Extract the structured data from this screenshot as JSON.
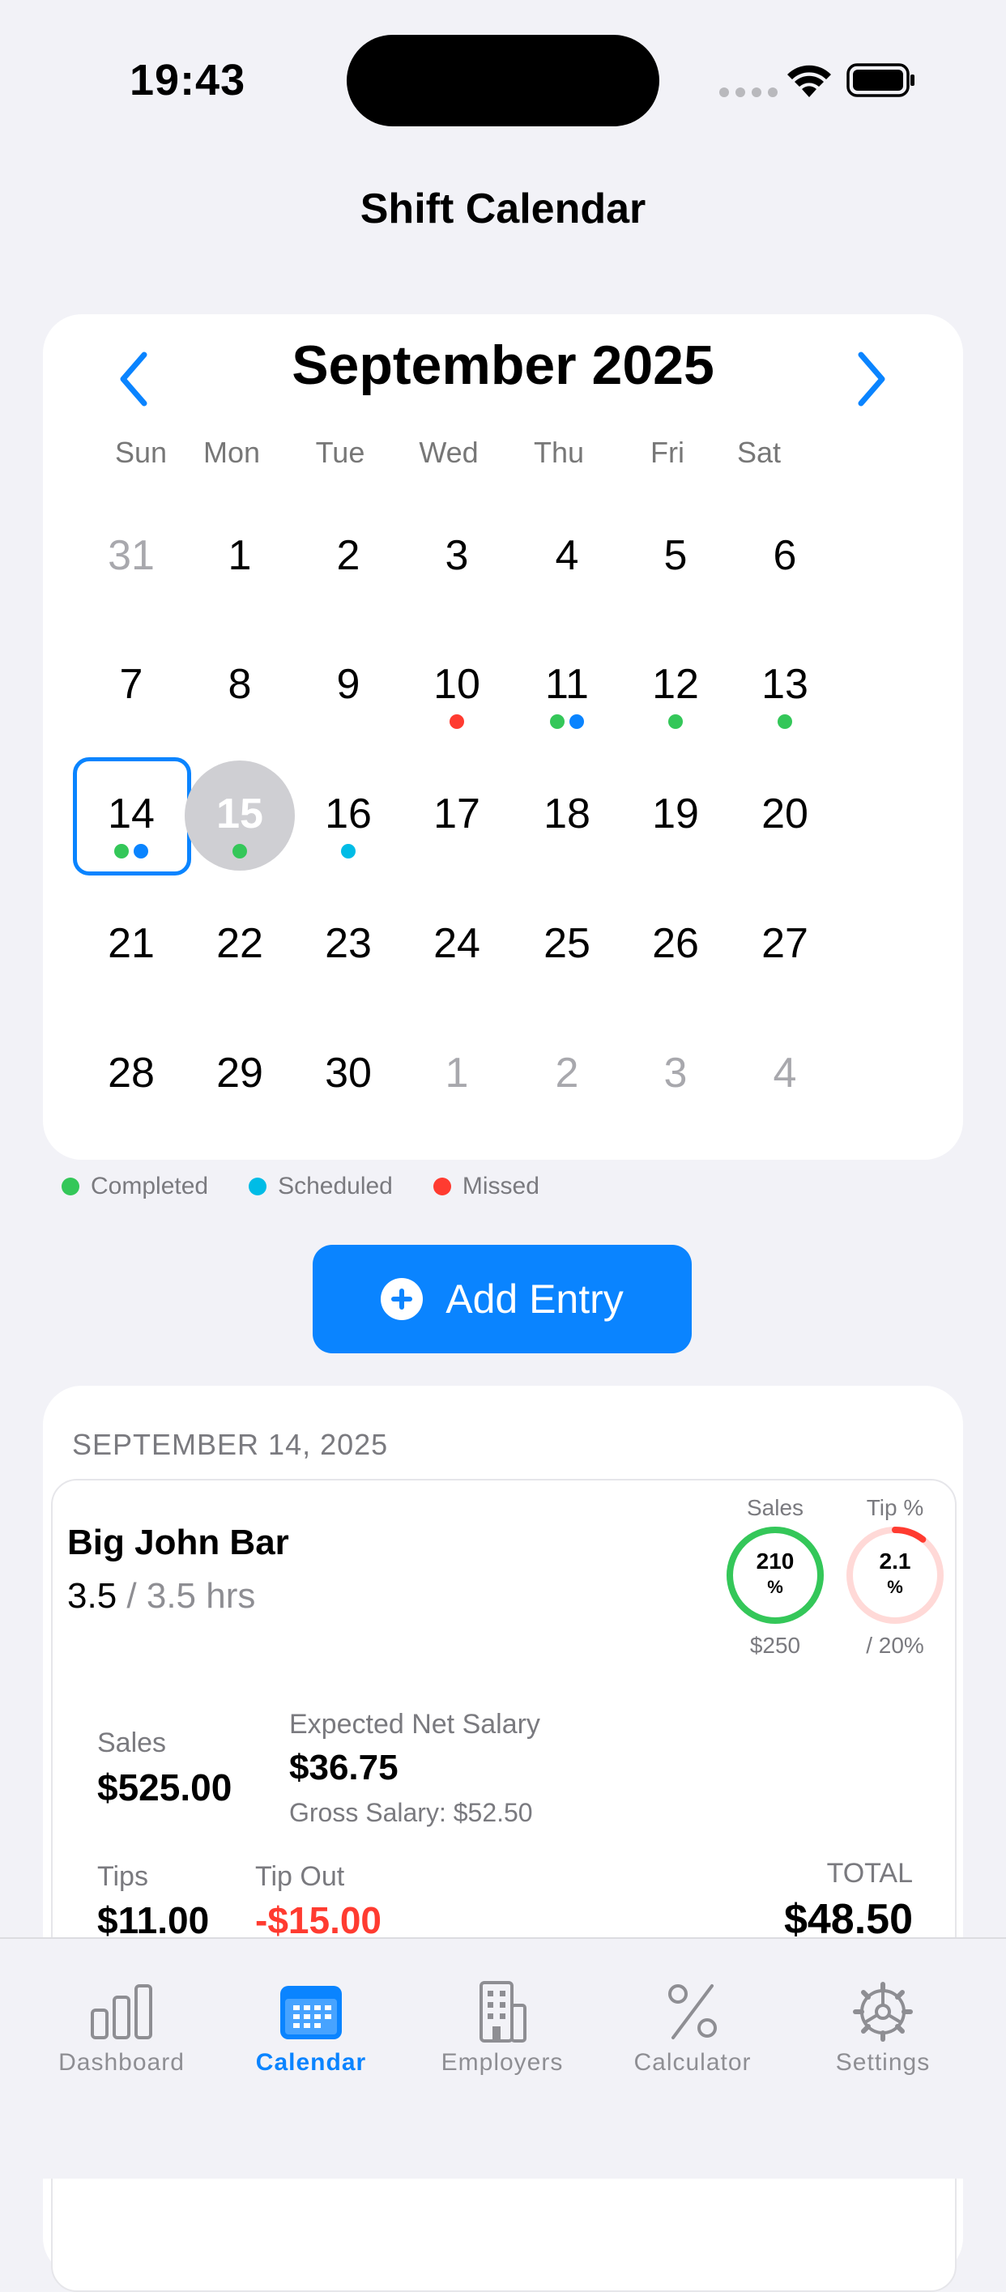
{
  "status_bar": {
    "time": "19:43"
  },
  "nav": {
    "title": "Shift Calendar"
  },
  "calendar": {
    "month_title": "September 2025",
    "weekdays": [
      "Sun",
      "Mon",
      "Tue",
      "Wed",
      "Thu",
      "Fri",
      "Sat"
    ],
    "weeks": [
      [
        {
          "d": "31",
          "muted": true
        },
        {
          "d": "1"
        },
        {
          "d": "2"
        },
        {
          "d": "3"
        },
        {
          "d": "4"
        },
        {
          "d": "5"
        },
        {
          "d": "6"
        }
      ],
      [
        {
          "d": "7"
        },
        {
          "d": "8"
        },
        {
          "d": "9"
        },
        {
          "d": "10",
          "dots": [
            "missed"
          ]
        },
        {
          "d": "11",
          "dots": [
            "completed",
            "blue"
          ]
        },
        {
          "d": "12",
          "dots": [
            "completed"
          ]
        },
        {
          "d": "13",
          "dots": [
            "completed"
          ]
        }
      ],
      [
        {
          "d": "14",
          "dots": [
            "completed",
            "blue"
          ],
          "selected": true
        },
        {
          "d": "15",
          "dots": [
            "completed"
          ],
          "today": true
        },
        {
          "d": "16",
          "dots": [
            "scheduled"
          ]
        },
        {
          "d": "17"
        },
        {
          "d": "18"
        },
        {
          "d": "19"
        },
        {
          "d": "20"
        }
      ],
      [
        {
          "d": "21"
        },
        {
          "d": "22"
        },
        {
          "d": "23"
        },
        {
          "d": "24"
        },
        {
          "d": "25"
        },
        {
          "d": "26"
        },
        {
          "d": "27"
        }
      ],
      [
        {
          "d": "28"
        },
        {
          "d": "29"
        },
        {
          "d": "30"
        },
        {
          "d": "1",
          "muted": true
        },
        {
          "d": "2",
          "muted": true
        },
        {
          "d": "3",
          "muted": true
        },
        {
          "d": "4",
          "muted": true
        }
      ]
    ]
  },
  "colors": {
    "completed": "#34C759",
    "scheduled": "#00BCE6",
    "missed": "#FF3B30",
    "blue": "#0A84FF",
    "accent": "#0A84FF"
  },
  "legend": [
    {
      "label": "Completed",
      "color": "#34C759"
    },
    {
      "label": "Scheduled",
      "color": "#00BCE6"
    },
    {
      "label": "Missed",
      "color": "#FF3B30"
    }
  ],
  "add_entry": {
    "label": "Add Entry"
  },
  "entries": {
    "date_header": "SEPTEMBER 14, 2025",
    "shift": {
      "employer": "Big John Bar",
      "hours_worked": "3.5",
      "hours_expected": "/ 3.5 hrs",
      "sales_ring": {
        "label": "Sales",
        "value": "210",
        "unit": "%",
        "target": "$250",
        "progress": 1.0
      },
      "tip_ring": {
        "label": "Tip %",
        "value": "2.1",
        "unit": "%",
        "target": "/ 20%",
        "progress": 0.105
      },
      "sales_label": "Sales",
      "sales_value": "$525.00",
      "expected_net_label": "Expected Net Salary",
      "expected_net_value": "$36.75",
      "gross_salary": "Gross Salary: $52.50",
      "tips_label": "Tips",
      "tips_value": "$11.00",
      "tip_out_label": "Tip Out",
      "tip_out_value": "-$15.00",
      "total_label": "TOTAL",
      "total_value": "$48.50"
    }
  },
  "tabbar": [
    {
      "label": "Dashboard",
      "icon": "chart-bars-icon",
      "active": false
    },
    {
      "label": "Calendar",
      "icon": "calendar-icon",
      "active": true
    },
    {
      "label": "Employers",
      "icon": "building-icon",
      "active": false
    },
    {
      "label": "Calculator",
      "icon": "percent-icon",
      "active": false
    },
    {
      "label": "Settings",
      "icon": "gear-icon",
      "active": false
    }
  ]
}
